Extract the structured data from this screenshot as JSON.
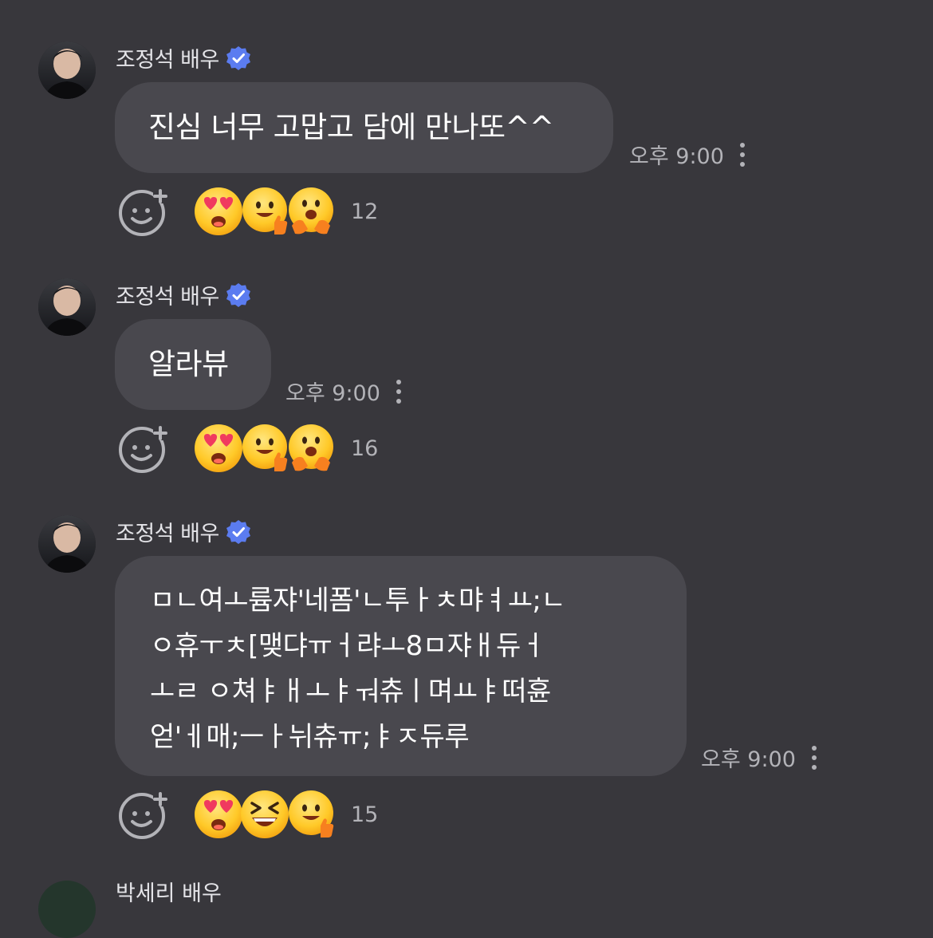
{
  "messages": [
    {
      "sender": "조정석 배우",
      "lines": [
        "진심 너무 고맙고 담에 만나또^^"
      ],
      "time": "오후 9:00",
      "reactions": [
        "heart-eyes",
        "thumbs-up-face",
        "hugging-face"
      ],
      "reaction_count": "12"
    },
    {
      "sender": "조정석 배우",
      "lines": [
        "알라뷰"
      ],
      "time": "오후 9:00",
      "reactions": [
        "heart-eyes",
        "thumbs-up-face",
        "hugging-face"
      ],
      "reaction_count": "16"
    },
    {
      "sender": "조정석 배우",
      "lines": [
        "ㅁㄴ여ㅗ륨쟈'네폼'ㄴ투ㅏㅊ먀ㅕㅛ;ㄴ",
        "ㅇ휴ㅜㅊ[맺댜ㅠㅓ랴ㅗ8ㅁ쟈ㅐ듀ㅓ",
        "ㅗㄹ ㅇ쳐ㅑㅐㅗㅑㅝ츄ㅣ며ㅛㅑ떠휸",
        "얻'ㅔ매;ㅡㅏ뉘츄ㅠ;ㅑㅈ듀루"
      ],
      "time": "오후 9:00",
      "reactions": [
        "heart-eyes",
        "laughing-face",
        "thumbs-up-face"
      ],
      "reaction_count": "15"
    }
  ],
  "next_sender_partial": "박세리 배우"
}
